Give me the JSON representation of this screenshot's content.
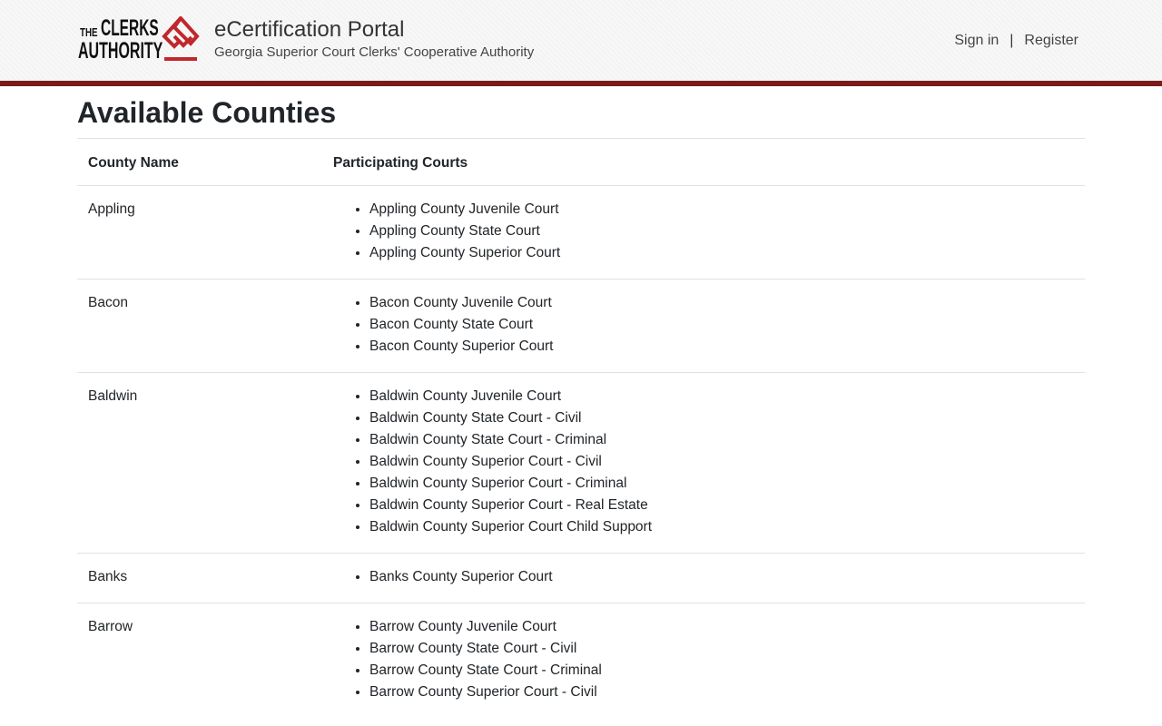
{
  "header": {
    "logo": {
      "the": "THE",
      "clerks": "CLERKS",
      "authority": "AUTHORITY"
    },
    "title": "eCertification Portal",
    "subtitle": "Georgia Superior Court Clerks' Cooperative Authority",
    "nav": {
      "sign_in": "Sign in",
      "separator": "|",
      "register": "Register"
    },
    "accent_color": "#7a1c1c",
    "logo_mark_color": "#c0272d"
  },
  "page_title": "Available Counties",
  "table": {
    "columns": [
      "County Name",
      "Participating Courts"
    ],
    "rows": [
      {
        "county": "Appling",
        "courts": [
          "Appling County Juvenile Court",
          "Appling County State Court",
          "Appling County Superior Court"
        ]
      },
      {
        "county": "Bacon",
        "courts": [
          "Bacon County Juvenile Court",
          "Bacon County State Court",
          "Bacon County Superior Court"
        ]
      },
      {
        "county": "Baldwin",
        "courts": [
          "Baldwin County Juvenile Court",
          "Baldwin County State Court - Civil",
          "Baldwin County State Court - Criminal",
          "Baldwin County Superior Court - Civil",
          "Baldwin County Superior Court - Criminal",
          "Baldwin County Superior Court - Real Estate",
          "Baldwin County Superior Court Child Support"
        ]
      },
      {
        "county": "Banks",
        "courts": [
          "Banks County Superior Court"
        ]
      },
      {
        "county": "Barrow",
        "courts": [
          "Barrow County Juvenile Court",
          "Barrow County State Court - Civil",
          "Barrow County State Court - Criminal",
          "Barrow County Superior Court - Civil"
        ]
      }
    ]
  }
}
